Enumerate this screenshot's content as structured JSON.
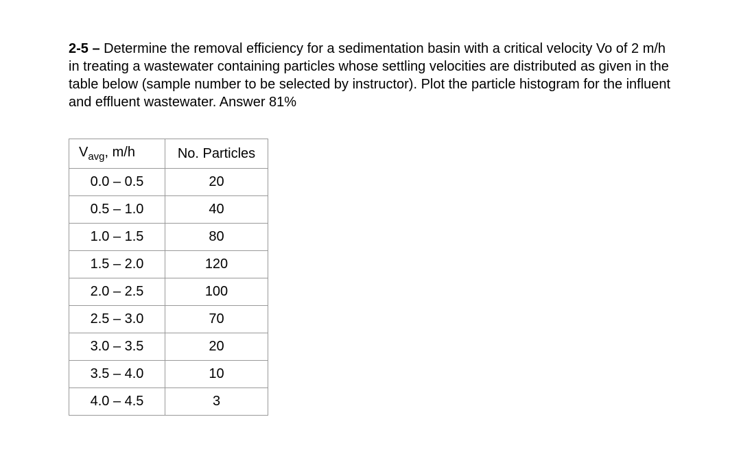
{
  "problem": {
    "number": "2-5 –",
    "text": "Determine the removal efficiency for a sedimentation basin with a critical velocity Vo of 2 m/h in treating a wastewater containing particles whose settling velocities are distributed as given in the table below (sample number to be selected by instructor). Plot the particle histogram for the influent and effluent wastewater.   Answer 81%"
  },
  "table": {
    "header_col1_prefix": "V",
    "header_col1_sub": "avg",
    "header_col1_suffix": ", m/h",
    "header_col2": "No. Particles",
    "rows": [
      {
        "range": "0.0 – 0.5",
        "count": "20"
      },
      {
        "range": "0.5 – 1.0",
        "count": "40"
      },
      {
        "range": "1.0 – 1.5",
        "count": "80"
      },
      {
        "range": "1.5 – 2.0",
        "count": "120"
      },
      {
        "range": "2.0 – 2.5",
        "count": "100"
      },
      {
        "range": "2.5 – 3.0",
        "count": "70"
      },
      {
        "range": "3.0 – 3.5",
        "count": "20"
      },
      {
        "range": "3.5 – 4.0",
        "count": "10"
      },
      {
        "range": "4.0 – 4.5",
        "count": "3"
      }
    ]
  }
}
